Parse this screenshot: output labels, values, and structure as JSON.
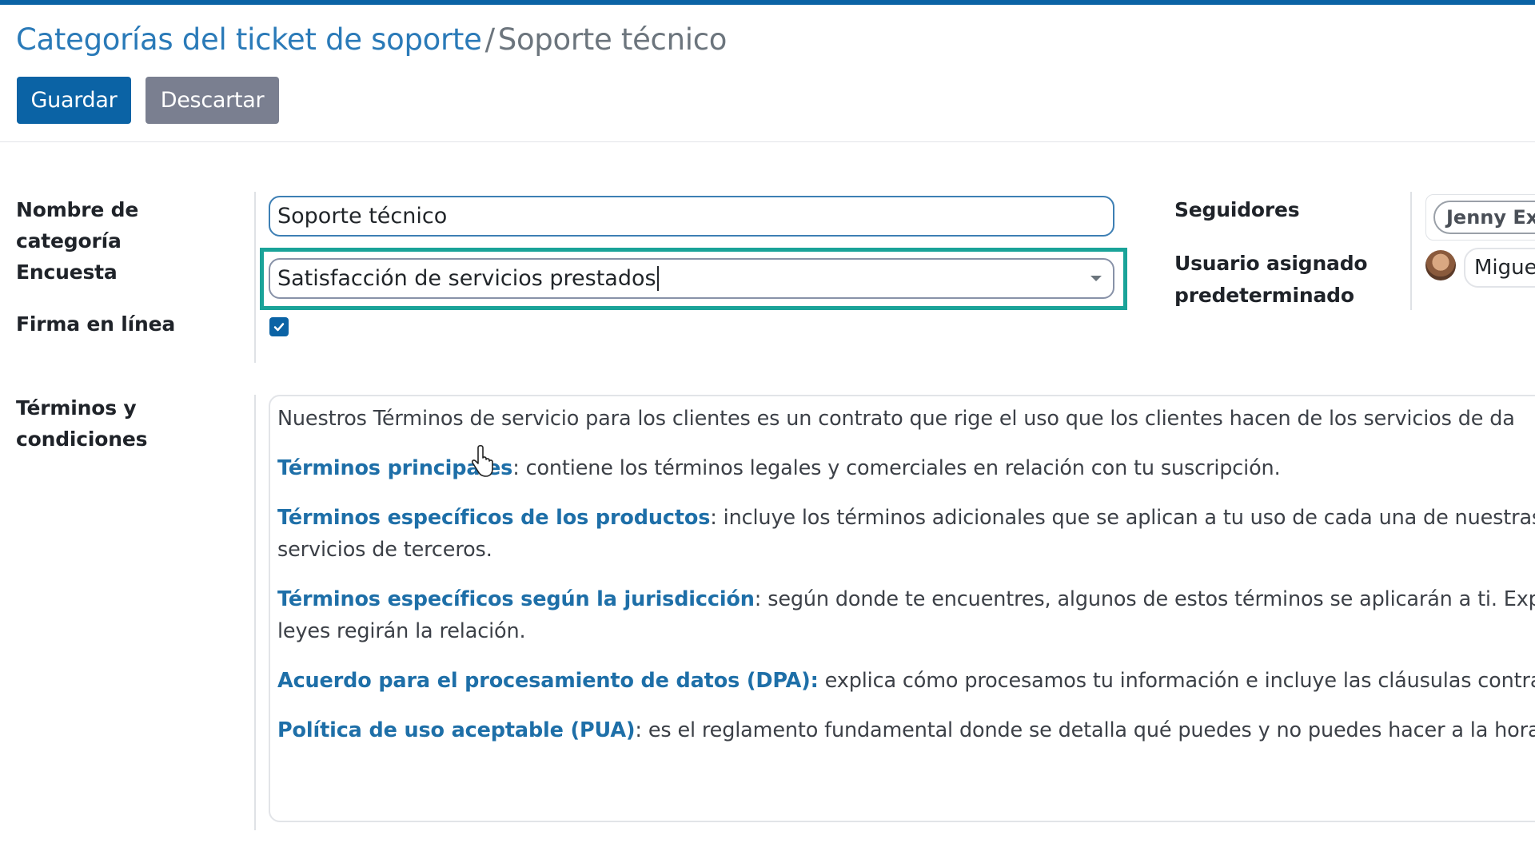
{
  "breadcrumb": {
    "parent": "Categorías del ticket de soporte",
    "separator": "/",
    "current": "Soporte técnico"
  },
  "toolbar": {
    "save_label": "Guardar",
    "discard_label": "Descartar"
  },
  "form": {
    "name_label_line1": "Nombre de",
    "name_label_line2": "categoría",
    "name_value": "Soporte técnico",
    "survey_label": "Encuesta",
    "survey_value": "Satisfacción de servicios prestados",
    "signature_label": "Firma en línea",
    "signature_checked": true,
    "terms_label_line1": "Términos y",
    "terms_label_line2": "condiciones"
  },
  "side": {
    "followers_label": "Seguidores",
    "followers_tag": "Jenny Exp",
    "assigned_label_line1": "Usuario asignado",
    "assigned_label_line2": "predeterminado",
    "assigned_user": "Miguel"
  },
  "terms": {
    "intro": "Nuestros Términos de servicio para los clientes es un contrato que rige el uso que los clientes hacen de los servicios de da",
    "p1_title": "Términos principales",
    "p1_text": ": contiene los términos legales y comerciales en relación con tu suscripción.",
    "p2_title": "Términos específicos de los productos",
    "p2_text": ": incluye los términos adicionales que se aplican a tu uso de cada una de nuestras",
    "p2_cont": "servicios de terceros.",
    "p3_title": "Términos específicos según la jurisdicción",
    "p3_text": ": según donde te encuentres, algunos de estos términos se aplicarán a ti. Explic",
    "p3_cont": "leyes regirán la relación.",
    "p4_title": "Acuerdo para el procesamiento de datos (DPA):",
    "p4_text": " explica cómo procesamos tu información e incluye las cláusulas contrac",
    "p5_title": "Política de uso aceptable (PUA)",
    "p5_text": ": es el reglamento fundamental donde se detalla qué puedes y no puedes hacer a la hora"
  },
  "colors": {
    "primary": "#0b63a5",
    "secondary": "#7a7f90",
    "highlight": "#1aa399",
    "link": "#1e6fa8"
  },
  "icons": [
    "check-icon",
    "dropdown-arrow-icon",
    "hand-pointer-cursor-icon"
  ]
}
